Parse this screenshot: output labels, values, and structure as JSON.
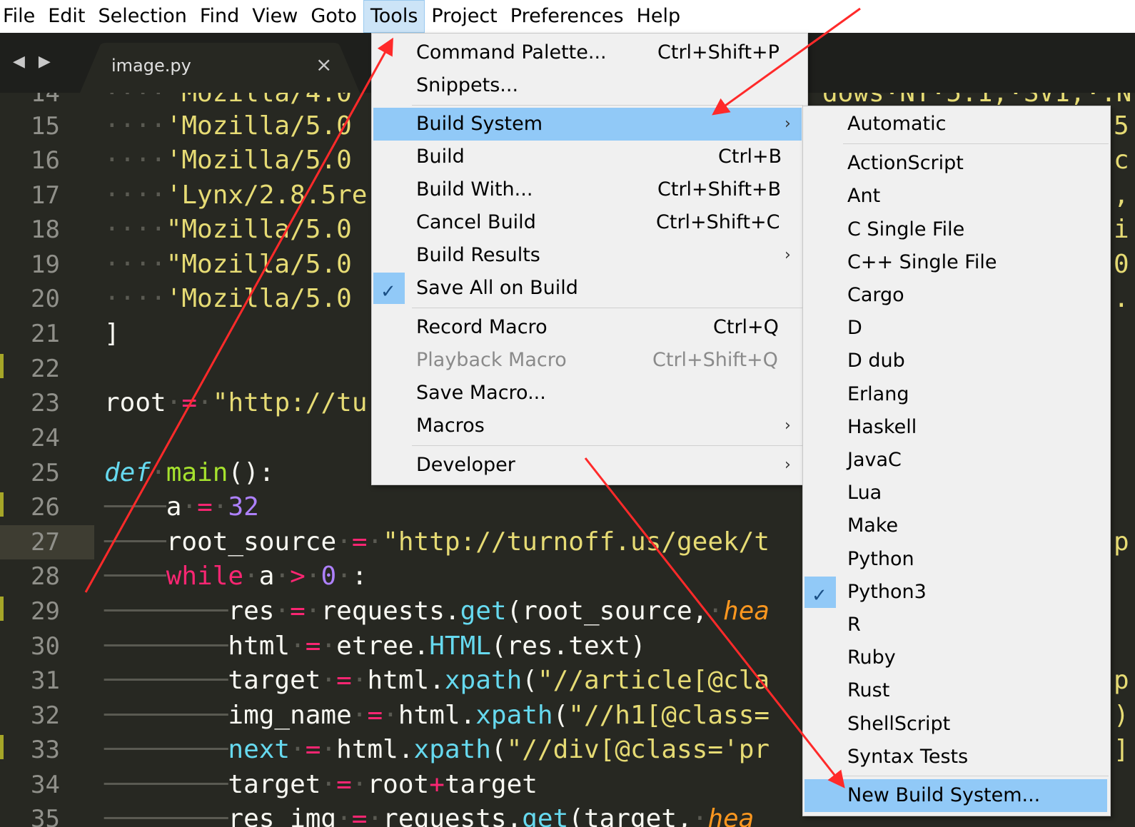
{
  "menubar": [
    "File",
    "Edit",
    "Selection",
    "Find",
    "View",
    "Goto",
    "Tools",
    "Project",
    "Preferences",
    "Help"
  ],
  "tab": {
    "title": "image.py",
    "close": "×",
    "nav": "◀ ▶"
  },
  "editor": {
    "line_numbers": [
      "14",
      "15",
      "16",
      "17",
      "18",
      "19",
      "20",
      "21",
      "22",
      "23",
      "24",
      "25",
      "26",
      "27",
      "28",
      "29",
      "30",
      "31",
      "32",
      "33",
      "34",
      "35"
    ],
    "peek_right": [
      "dows·NT·5.1;·SV1;·.N",
      "5",
      "c",
      ",",
      "i",
      "0",
      ".",
      "",
      "",
      "",
      "",
      "",
      "",
      "",
      "p",
      "",
      "",
      "p",
      ")",
      "]"
    ]
  },
  "tools_menu": {
    "items": [
      {
        "label": "Command Palette...",
        "shortcut": "Ctrl+Shift+P"
      },
      {
        "label": "Snippets...",
        "shortcut": ""
      },
      {
        "label": "Build System",
        "shortcut": "",
        "submenu": "›"
      },
      {
        "label": "Build",
        "shortcut": "Ctrl+B"
      },
      {
        "label": "Build With...",
        "shortcut": "Ctrl+Shift+B"
      },
      {
        "label": "Cancel Build",
        "shortcut": "Ctrl+Shift+C"
      },
      {
        "label": "Build Results",
        "shortcut": "",
        "submenu": "›"
      },
      {
        "label": "Save All on Build",
        "shortcut": "",
        "checked": "✓"
      },
      {
        "label": "Record Macro",
        "shortcut": "Ctrl+Q"
      },
      {
        "label": "Playback Macro",
        "shortcut": "Ctrl+Shift+Q"
      },
      {
        "label": "Save Macro...",
        "shortcut": ""
      },
      {
        "label": "Macros",
        "shortcut": "",
        "submenu": "›"
      },
      {
        "label": "Developer",
        "shortcut": "",
        "submenu": "›"
      }
    ]
  },
  "build_system_menu": {
    "items": [
      "Automatic",
      "ActionScript",
      "Ant",
      "C Single File",
      "C++ Single File",
      "Cargo",
      "D",
      "D dub",
      "Erlang",
      "Haskell",
      "JavaC",
      "Lua",
      "Make",
      "Python",
      "Python3",
      "R",
      "Ruby",
      "Rust",
      "ShellScript",
      "Syntax Tests",
      "New Build System..."
    ],
    "checked_item": "Python3",
    "check": "✓"
  },
  "colors": {
    "editor_bg": "#272822",
    "highlight": "#91c9f7",
    "annotation": "#ff2a2a"
  }
}
